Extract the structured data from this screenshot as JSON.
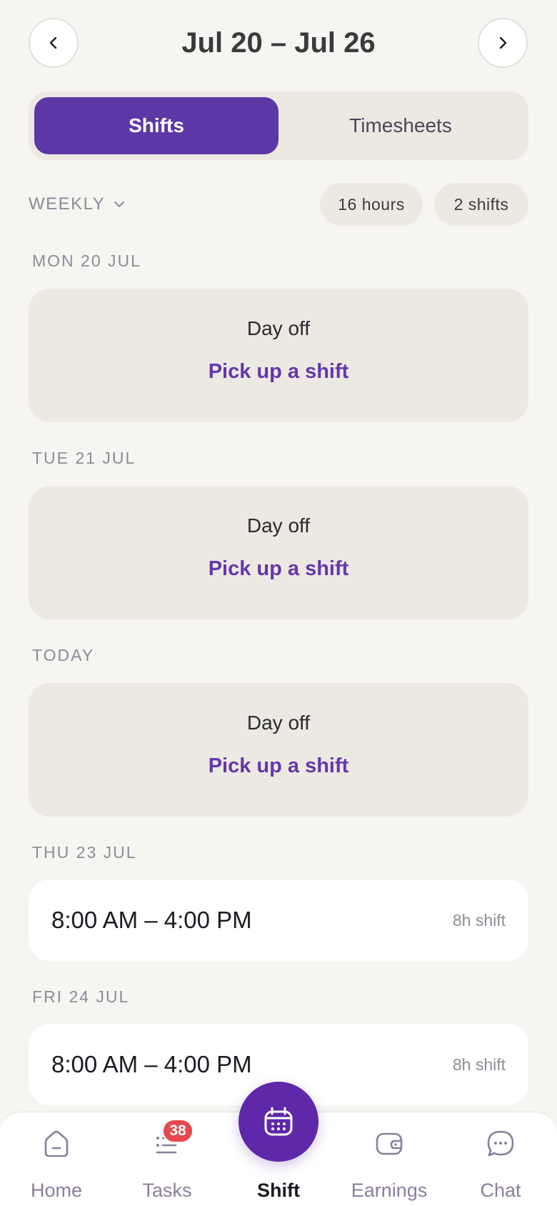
{
  "header": {
    "date_range": "Jul 20 – Jul 26",
    "prev_icon": "chevron-left-icon",
    "next_icon": "chevron-right-icon"
  },
  "segmented": {
    "tabs": [
      {
        "label": "Shifts",
        "active": true
      },
      {
        "label": "Timesheets",
        "active": false
      }
    ]
  },
  "filter": {
    "period": "WEEKLY",
    "hours_pill": "16 hours",
    "shifts_pill": "2 shifts"
  },
  "days": [
    {
      "label": "MON 20 JUL",
      "type": "off",
      "off_text": "Day off",
      "action": "Pick up a shift"
    },
    {
      "label": "TUE 21 JUL",
      "type": "off",
      "off_text": "Day off",
      "action": "Pick up a shift"
    },
    {
      "label": "TODAY",
      "type": "off",
      "off_text": "Day off",
      "action": "Pick up a shift"
    },
    {
      "label": "THU 23 JUL",
      "type": "shift",
      "time": "8:00 AM – 4:00 PM",
      "duration": "8h shift"
    },
    {
      "label": "FRI 24 JUL",
      "type": "shift",
      "time": "8:00 AM – 4:00 PM",
      "duration": "8h shift"
    }
  ],
  "bottom_nav": {
    "items": [
      {
        "label": "Home",
        "icon": "home-icon"
      },
      {
        "label": "Tasks",
        "icon": "tasks-icon",
        "badge": "38"
      },
      {
        "label": "Shift",
        "icon": "calendar-icon",
        "active": true
      },
      {
        "label": "Earnings",
        "icon": "wallet-icon"
      },
      {
        "label": "Chat",
        "icon": "chat-icon"
      }
    ]
  },
  "colors": {
    "accent": "#5e37a6",
    "link": "#6537ad",
    "badge": "#e5484d",
    "background": "#f6f5f2",
    "card_off": "#ece9e3"
  }
}
